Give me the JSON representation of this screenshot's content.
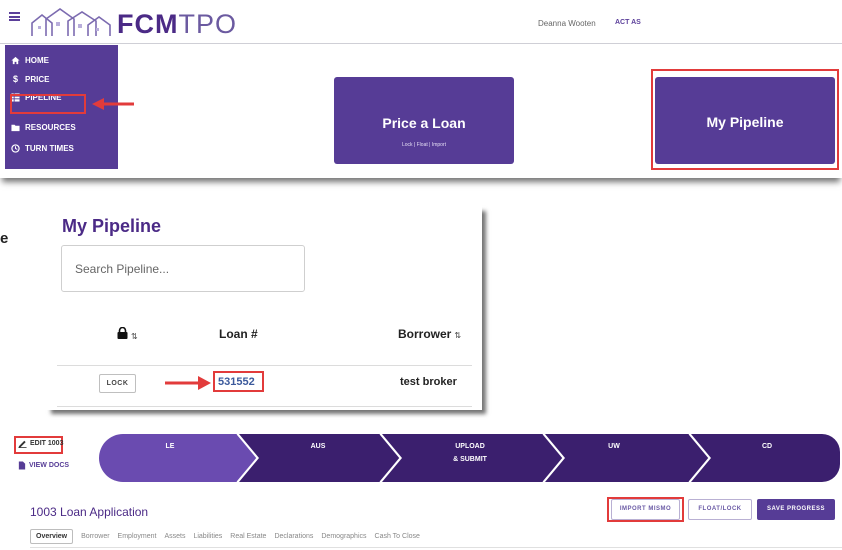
{
  "header": {
    "logo_bold": "FCM",
    "logo_light": "TPO",
    "user_name": "Deanna Wooten",
    "act_as": "ACT AS"
  },
  "sidebar": {
    "items": [
      {
        "label": "HOME",
        "icon": "home-icon"
      },
      {
        "label": "PRICE",
        "icon": "dollar-icon"
      },
      {
        "label": "PIPELINE",
        "icon": "table-icon"
      },
      {
        "label": "RESOURCES",
        "icon": "folder-icon"
      },
      {
        "label": "TURN TIMES",
        "icon": "clock-icon"
      }
    ]
  },
  "cards": {
    "price": {
      "title": "Price a Loan",
      "subtitle": "Lock | Float | Import"
    },
    "pipeline": {
      "title": "My Pipeline"
    }
  },
  "pipeline": {
    "title": "My Pipeline",
    "search_placeholder": "Search Pipeline...",
    "columns": [
      "Loan #",
      "Borrower"
    ],
    "rows": [
      {
        "action": "LOCK",
        "loan_number": "531552",
        "borrower": "test broker"
      }
    ]
  },
  "side_fragment": "e",
  "loan_app": {
    "edit_label": "EDIT 1003",
    "view_docs_label": "VIEW DOCS",
    "steps": [
      "LE",
      "AUS",
      "UPLOAD",
      "& SUBMIT",
      "UW",
      "CD"
    ],
    "title": "1003 Loan Application",
    "buttons": {
      "import": "IMPORT MISMO",
      "float_lock": "FLOAT/LOCK",
      "save": "SAVE PROGRESS"
    },
    "tabs": [
      "Overview",
      "Borrower",
      "Employment",
      "Assets",
      "Liabilities",
      "Real Estate",
      "Declarations",
      "Demographics",
      "Cash To Close"
    ]
  },
  "colors": {
    "brand_purple": "#563c96",
    "highlight_red": "#e23b3b",
    "link_blue": "#3c5a9c"
  }
}
